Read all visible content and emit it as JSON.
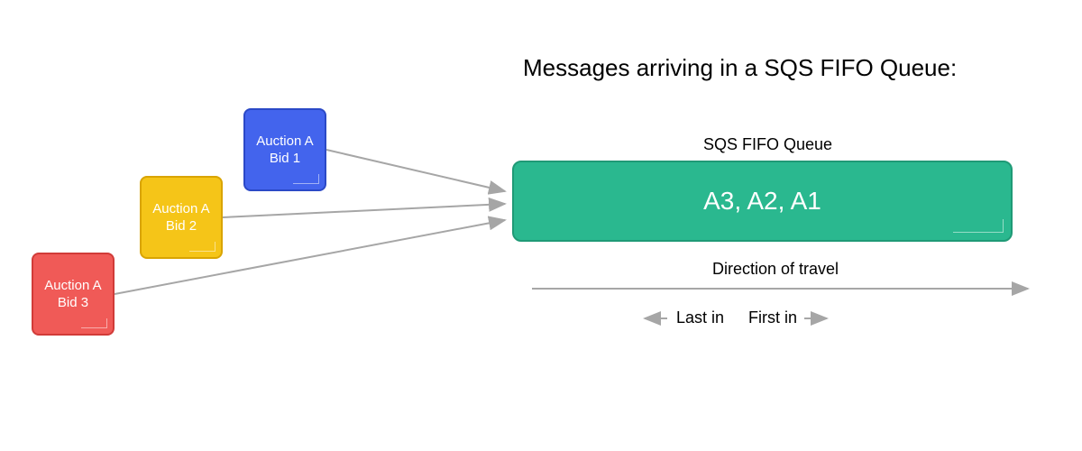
{
  "title": "Messages arriving in a SQS FIFO Queue:",
  "queue_label": "SQS FIFO Queue",
  "bids": {
    "bid1": {
      "line1": "Auction A",
      "line2": "Bid 1"
    },
    "bid2": {
      "line1": "Auction A",
      "line2": "Bid 2"
    },
    "bid3": {
      "line1": "Auction A",
      "line2": "Bid 3"
    }
  },
  "queue_content": "A3, A2, A1",
  "direction_label": "Direction of travel",
  "last_in_label": "Last in",
  "first_in_label": "First in",
  "colors": {
    "bid1": "#4364ed",
    "bid2": "#f5c518",
    "bid3": "#f05a57",
    "queue": "#2ab88f",
    "arrow": "#a6a6a6"
  }
}
